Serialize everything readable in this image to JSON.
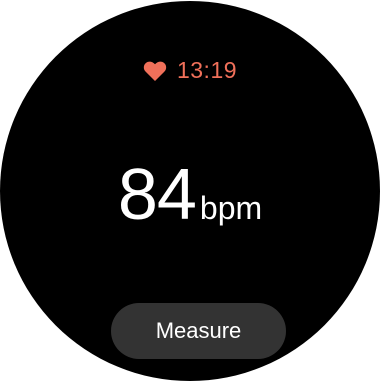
{
  "status": {
    "icon": "heart-icon",
    "time": "13:19",
    "accent_color": "#f0705a"
  },
  "heart_rate": {
    "value": "84",
    "unit": "bpm"
  },
  "actions": {
    "measure_label": "Measure"
  }
}
